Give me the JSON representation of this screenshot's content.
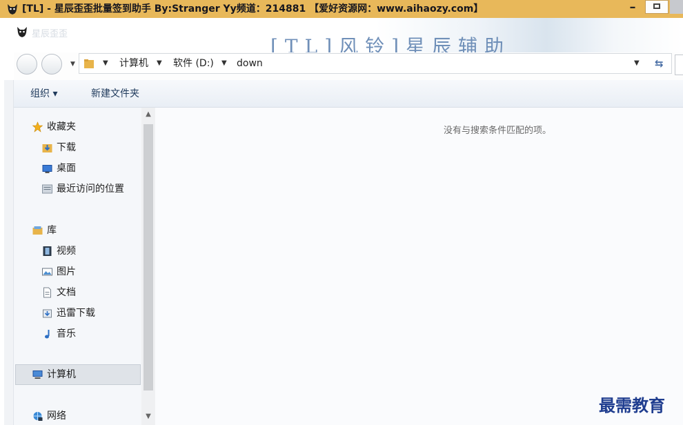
{
  "window": {
    "title": "[TL] - 星辰歪歪批量签到助手        By:Stranger    Yy频道：214881     【爱好资源网：www.aihaozy.com】",
    "minimize_label": "–"
  },
  "banner": {
    "title": "[TL]风铃]星辰辅助",
    "ghost_text": "星辰歪歪"
  },
  "address_bar": {
    "crumbs": [
      "计算机",
      "软件 (D:)",
      "down"
    ],
    "separator": "▼",
    "refresh_icon": "refresh-icon"
  },
  "toolbar": {
    "organize_label": "组织 ▾",
    "new_folder_label": "新建文件夹"
  },
  "nav": {
    "favorites": {
      "label": "收藏夹",
      "icon": "star-icon"
    },
    "favorites_items": [
      {
        "label": "下载",
        "icon": "downloads-folder-icon"
      },
      {
        "label": "桌面",
        "icon": "desktop-icon"
      },
      {
        "label": "最近访问的位置",
        "icon": "recent-places-icon"
      }
    ],
    "libraries": {
      "label": "库",
      "icon": "library-icon"
    },
    "library_items": [
      {
        "label": "视频",
        "icon": "video-icon"
      },
      {
        "label": "图片",
        "icon": "pictures-icon"
      },
      {
        "label": "文档",
        "icon": "documents-icon"
      },
      {
        "label": "迅雷下载",
        "icon": "thunder-download-icon"
      },
      {
        "label": "音乐",
        "icon": "music-icon"
      }
    ],
    "computer": {
      "label": "计算机",
      "icon": "computer-icon"
    },
    "network": {
      "label": "网络",
      "icon": "network-icon"
    }
  },
  "content": {
    "empty_message": "没有与搜索条件匹配的项。"
  },
  "watermark": "最需教育",
  "colors": {
    "titlebar": "#e8b85a",
    "banner_text": "#6f8fb8",
    "watermark": "#1f3d8f"
  }
}
